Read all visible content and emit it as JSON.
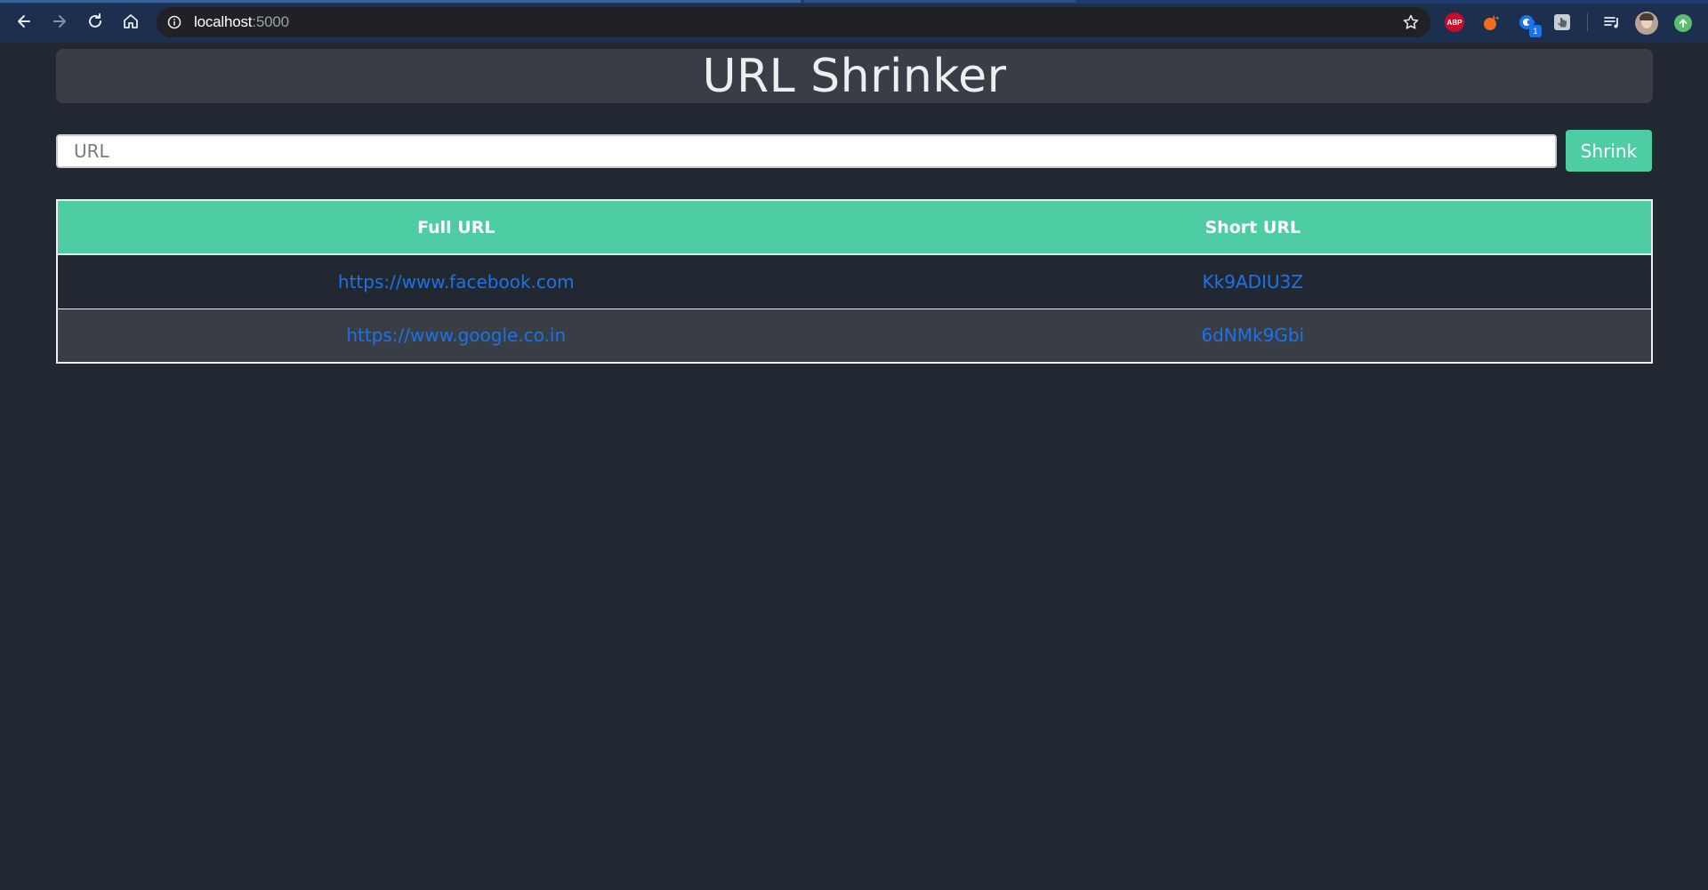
{
  "browser": {
    "url_host": "localhost",
    "url_port": ":5000",
    "icons": {
      "back": "arrow-left-icon",
      "forward": "arrow-right-icon",
      "reload": "reload-icon",
      "home": "home-icon",
      "info": "info-icon",
      "star": "star-icon"
    },
    "extensions": {
      "abp_label": "ABP",
      "badge_count": "1"
    }
  },
  "header": {
    "title": "URL Shrinker"
  },
  "form": {
    "url_placeholder": "URL",
    "url_value": "",
    "submit_label": "Shrink"
  },
  "table": {
    "columns": [
      "Full URL",
      "Short URL"
    ],
    "rows": [
      {
        "full_url": "https://www.facebook.com",
        "short_url": "Kk9ADIU3Z"
      },
      {
        "full_url": "https://www.google.co.in",
        "short_url": "6dNMk9Gbi"
      }
    ]
  },
  "colors": {
    "background": "#222831",
    "card": "#393e46",
    "accent": "#4ecca3",
    "text": "#eeeeee",
    "link": "#1a73e8"
  }
}
